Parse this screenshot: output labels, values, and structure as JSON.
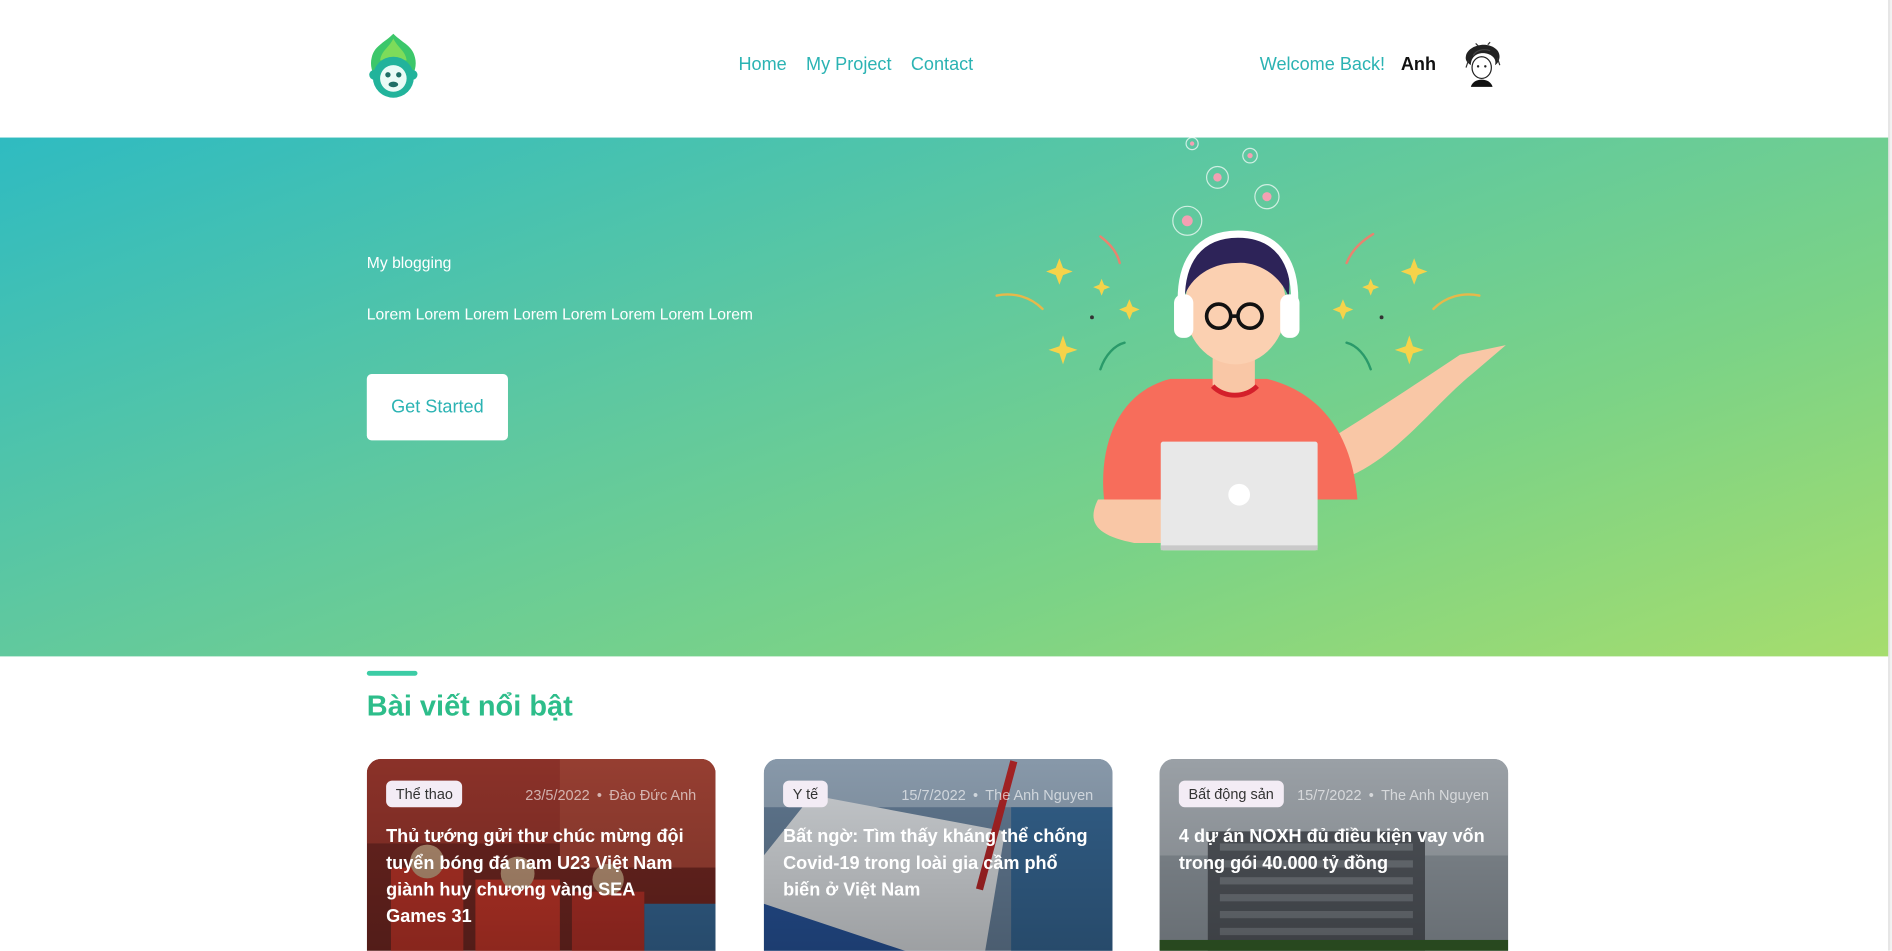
{
  "header": {
    "nav": [
      {
        "label": "Home"
      },
      {
        "label": "My Project"
      },
      {
        "label": "Contact"
      }
    ],
    "welcome": "Welcome Back!",
    "username": "Anh"
  },
  "hero": {
    "title": "My blogging",
    "subtitle": "Lorem Lorem Lorem Lorem Lorem Lorem Lorem Lorem",
    "button": "Get Started"
  },
  "featured": {
    "title": "Bài viết nổi bật",
    "cards": [
      {
        "category": "Thể thao",
        "date": "23/5/2022",
        "author": "Đào Đức Anh",
        "title": "Thủ tướng gửi thư chúc mừng đội tuyển bóng đá nam U23 Việt Nam giành huy chương vàng SEA Games 31"
      },
      {
        "category": "Y tế",
        "date": "15/7/2022",
        "author": "The Anh Nguyen",
        "title": "Bất ngờ: Tìm thấy kháng thể chống Covid-19 trong loài gia cầm phổ biến ở Việt Nam"
      },
      {
        "category": "Bất động sản",
        "date": "15/7/2022",
        "author": "The Anh Nguyen",
        "title": "4 dự án NOXH đủ điều kiện vay vốn trong gói 40.000 tỷ đồng"
      }
    ]
  },
  "colors": {
    "accent": "#2bb3b3",
    "heading": "#2dbd8a",
    "hero_start": "#2fbbc1",
    "hero_end": "#a6dd6d"
  },
  "icons": {
    "logo": "monkey-leaf-logo",
    "avatar": "user-sketch-avatar"
  }
}
